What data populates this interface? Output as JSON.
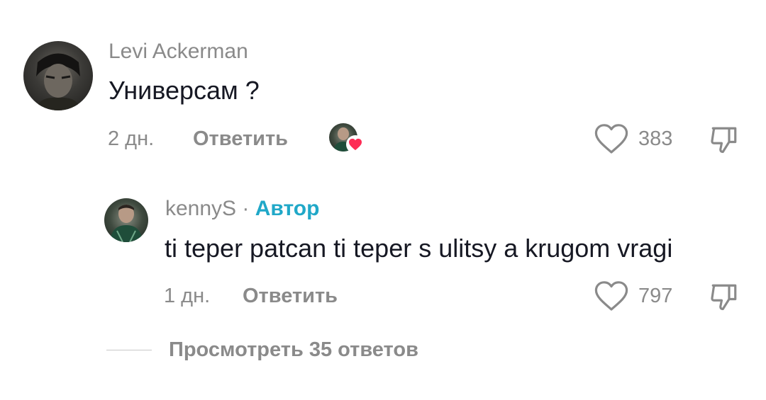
{
  "comments": [
    {
      "username": "Levi Ackerman",
      "text": "Универсам ?",
      "time": "2 дн.",
      "reply_label": "Ответить",
      "likes": "383"
    },
    {
      "username": "kennyS",
      "separator": "·",
      "author_badge": "Автор",
      "text": "ti teper patcan ti teper s ulitsy a krugom vragi",
      "time": "1 дн.",
      "reply_label": "Ответить",
      "likes": "797"
    }
  ],
  "view_replies_label": "Просмотреть 35 ответов",
  "colors": {
    "text": "#161823",
    "muted": "#8a8a8a",
    "author": "#20a8c8",
    "heart_badge": "#fe2c55"
  },
  "icons": [
    "heart-outline-icon",
    "thumbs-down-icon",
    "heart-filled-icon"
  ]
}
